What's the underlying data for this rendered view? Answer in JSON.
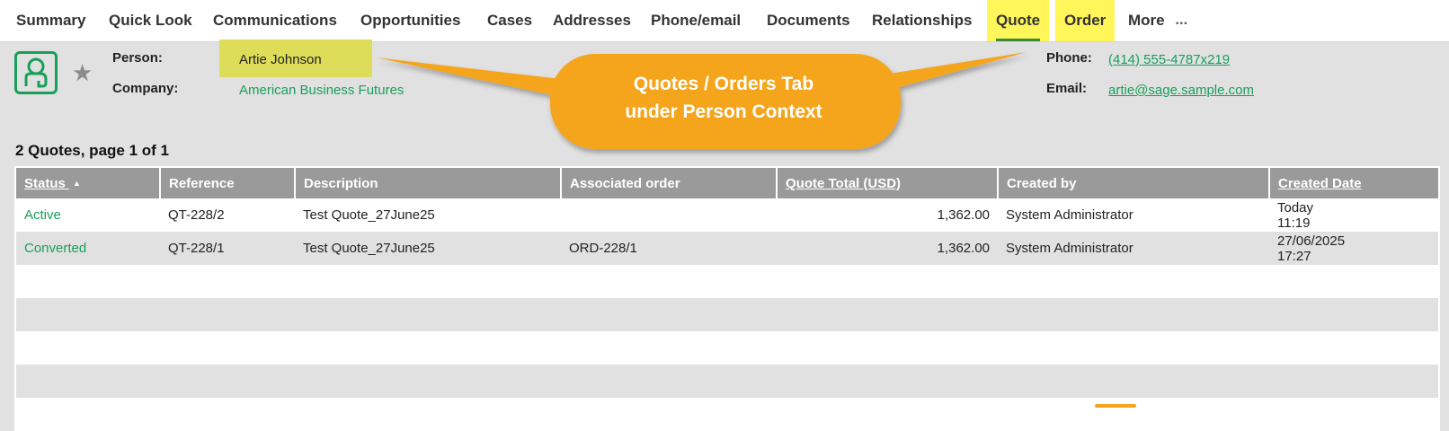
{
  "tabs": [
    {
      "label": "Summary",
      "highlight": false
    },
    {
      "label": "Quick Look",
      "highlight": false
    },
    {
      "label": "Communications",
      "highlight": false
    },
    {
      "label": "Opportunities",
      "highlight": false
    },
    {
      "label": "Cases",
      "highlight": false
    },
    {
      "label": "Addresses",
      "highlight": false
    },
    {
      "label": "Phone/email",
      "highlight": false
    },
    {
      "label": "Documents",
      "highlight": false
    },
    {
      "label": "Relationships",
      "highlight": false
    },
    {
      "label": "Quote",
      "highlight": true,
      "active": true
    },
    {
      "label": "Order",
      "highlight": true
    },
    {
      "label": "More",
      "highlight": false
    }
  ],
  "header": {
    "person_label": "Person:",
    "person_name": "Artie Johnson",
    "company_label": "Company:",
    "company_name": "American Business Futures",
    "phone_label": "Phone:",
    "phone_value": "(414) 555-4787x219",
    "email_label": "Email:",
    "email_value": "artie@sage.sample.com"
  },
  "callout": {
    "line1": "Quotes / Orders Tab",
    "line2": "under Person Context"
  },
  "list": {
    "title": "2 Quotes, page 1 of 1",
    "columns": [
      "Status",
      "Reference",
      "Description",
      "Associated order",
      "Quote Total (USD)",
      "Created by",
      "Created Date"
    ],
    "sort_arrow": "▲",
    "rows": [
      {
        "status": "Active",
        "reference": "QT-228/2",
        "description": "Test Quote_27June25",
        "order": "",
        "total": "1,362.00",
        "created_by": "System Administrator",
        "date": "Today",
        "time": "11:19"
      },
      {
        "status": "Converted",
        "reference": "QT-228/1",
        "description": "Test Quote_27June25",
        "order": "ORD-228/1",
        "total": "1,362.00",
        "created_by": "System Administrator",
        "date": "27/06/2025",
        "time": "17:27"
      }
    ]
  },
  "colors": {
    "accent_green": "#18a05a",
    "highlight_yellow": "#fff65a",
    "callout_orange": "#f5a51d",
    "header_grey": "#9a9a9a"
  }
}
